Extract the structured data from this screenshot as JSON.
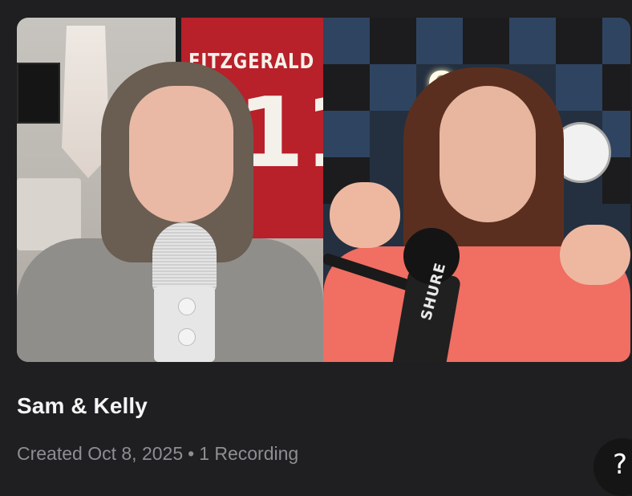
{
  "card": {
    "title": "Sam & Kelly",
    "created_label": "Created Oct 8, 2025",
    "separator": "•",
    "recordings_label": "1 Recording"
  },
  "thumbnail": {
    "left_pane": {
      "jersey_name": "FITZGERALD",
      "jersey_number": "11"
    },
    "right_pane": {
      "neon_sign": "O",
      "mic_brand": "SHURE"
    }
  },
  "help": {
    "label": "?",
    "icon": "question-mark-icon"
  },
  "colors": {
    "background": "#1f1f21",
    "title": "#f5f5f5",
    "meta": "#8e8e93"
  }
}
